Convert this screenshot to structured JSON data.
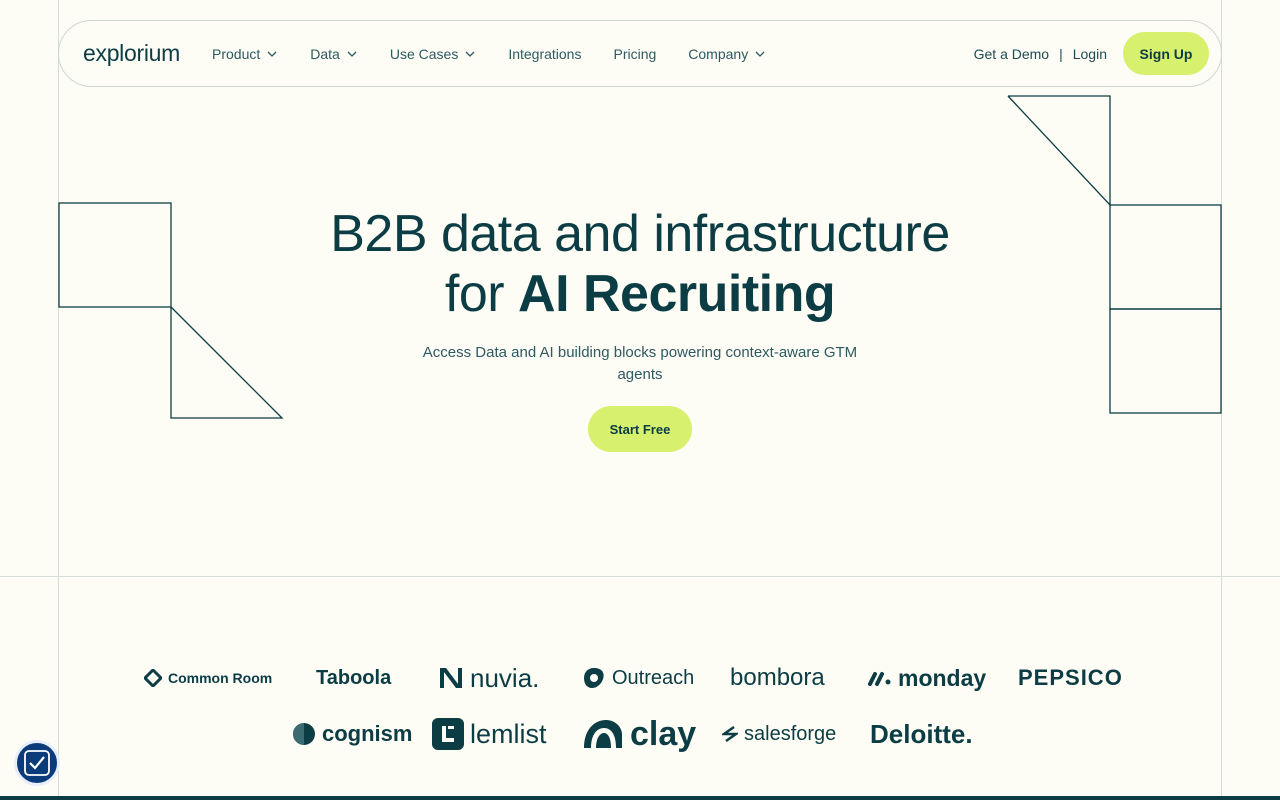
{
  "nav": {
    "logo": "explorium",
    "items": [
      {
        "label": "Product",
        "dropdown": true
      },
      {
        "label": "Data",
        "dropdown": true
      },
      {
        "label": "Use Cases",
        "dropdown": true
      },
      {
        "label": "Integrations",
        "dropdown": false
      },
      {
        "label": "Pricing",
        "dropdown": false
      },
      {
        "label": "Company",
        "dropdown": true
      }
    ],
    "demo": "Get a Demo",
    "separator": "|",
    "login": "Login",
    "signup": "Sign Up"
  },
  "hero": {
    "line1": "B2B data and infrastructure",
    "line2_prefix": "for ",
    "line2_bold": "AI Recruiting",
    "subtitle": "Access Data and AI building blocks powering context-aware GTM agents",
    "cta": "Start Free"
  },
  "logos": {
    "row1": [
      "Common Room",
      "Taboola",
      "nuvia.",
      "Outreach",
      "bombora",
      "monday",
      "PEPSICO"
    ],
    "row2": [
      "cognism",
      "lemlist",
      "clay",
      "salesforge",
      "Deloitte."
    ]
  },
  "colors": {
    "background": "#fdfcf5",
    "primary": "#0c3c44",
    "accent": "#d7f06e",
    "badge": "#0b3b7a"
  }
}
